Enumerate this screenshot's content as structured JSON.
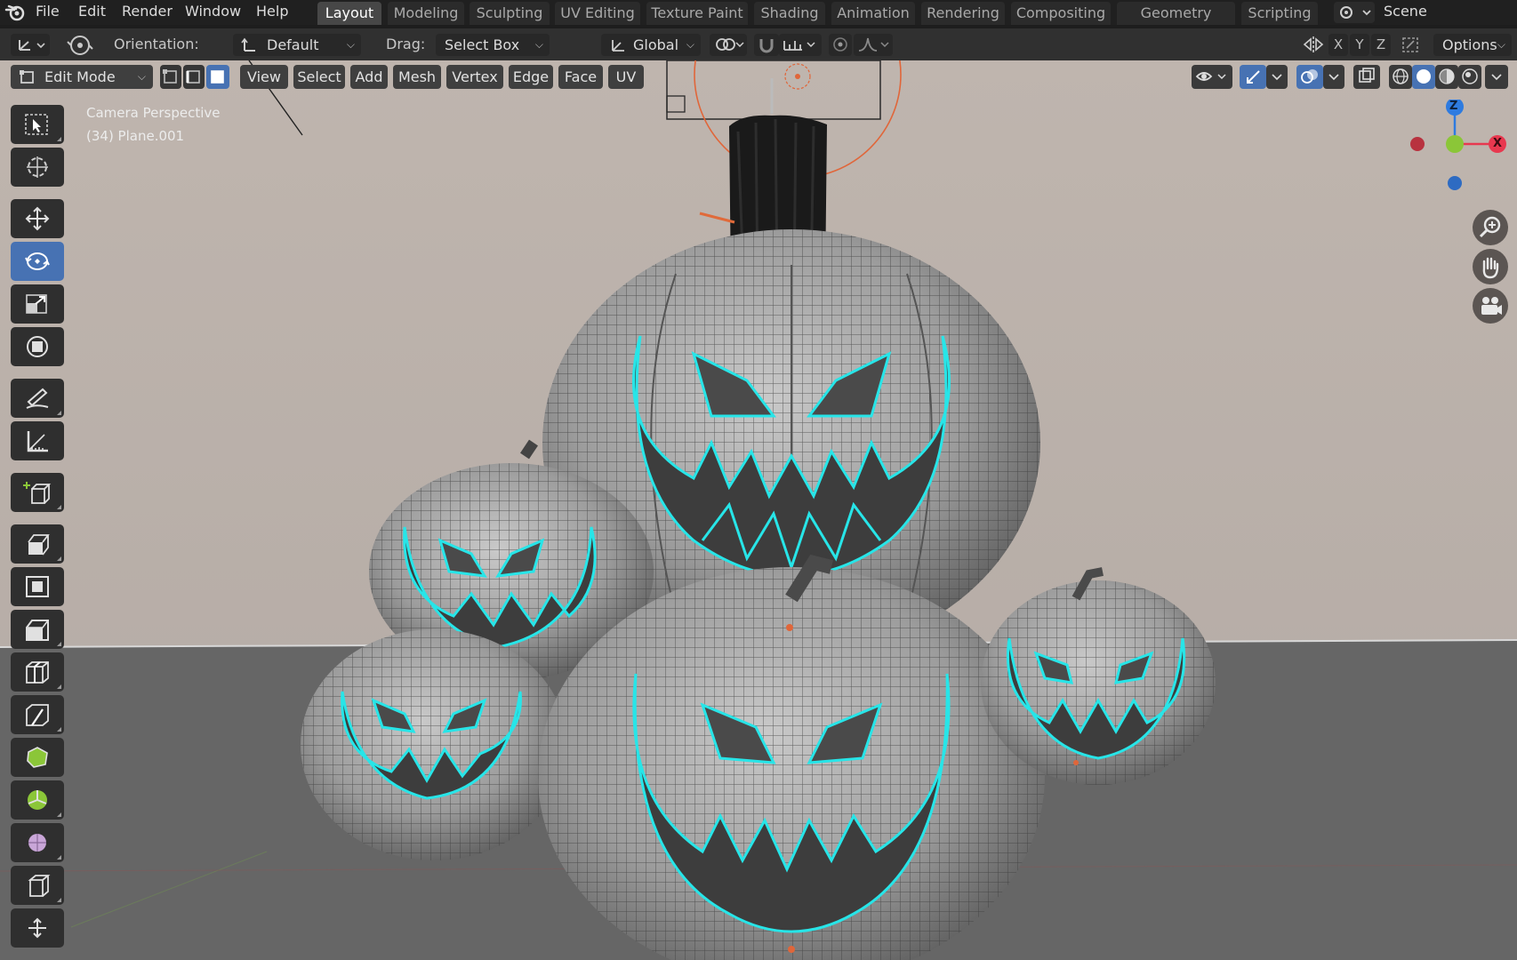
{
  "menubar": {
    "items": [
      "File",
      "Edit",
      "Render",
      "Window",
      "Help"
    ],
    "workspaces": [
      "Layout",
      "Modeling",
      "Sculpting",
      "UV Editing",
      "Texture Paint",
      "Shading",
      "Animation",
      "Rendering",
      "Compositing",
      "Geometry Nodes",
      "Scripting"
    ],
    "active_workspace": "Layout",
    "scene_label": "Scene"
  },
  "tool_settings": {
    "orientation_label": "Orientation:",
    "orientation_value": "Default",
    "drag_label": "Drag:",
    "drag_value": "Select Box",
    "transform_orientation": "Global",
    "axis_x": "X",
    "axis_y": "Y",
    "axis_z": "Z",
    "options_label": "Options"
  },
  "header": {
    "mode": "Edit Mode",
    "menus": [
      "View",
      "Select",
      "Add",
      "Mesh",
      "Vertex",
      "Edge",
      "Face",
      "UV"
    ]
  },
  "viewport": {
    "view_name": "Camera Perspective",
    "object_info": "(34) Plane.001",
    "gizmo": {
      "z": "Z",
      "x": "X"
    }
  },
  "toolbar": {
    "tools": [
      "select-box",
      "cursor",
      "move",
      "rotate",
      "scale",
      "transform",
      "annotate",
      "measure",
      "add-cube",
      "extrude",
      "inset",
      "bevel",
      "loop-cut",
      "knife",
      "poly-build",
      "spin",
      "smooth",
      "shear",
      "shrink-fatten"
    ],
    "active_tool": "rotate"
  },
  "colors": {
    "accent": "#4772b3",
    "wire_highlight": "#27e5e8",
    "background_wall": "#b7aea8",
    "floor": "#646464",
    "axis_x": "#e8384f",
    "axis_y": "#8bc638",
    "axis_z": "#2e7be0"
  }
}
